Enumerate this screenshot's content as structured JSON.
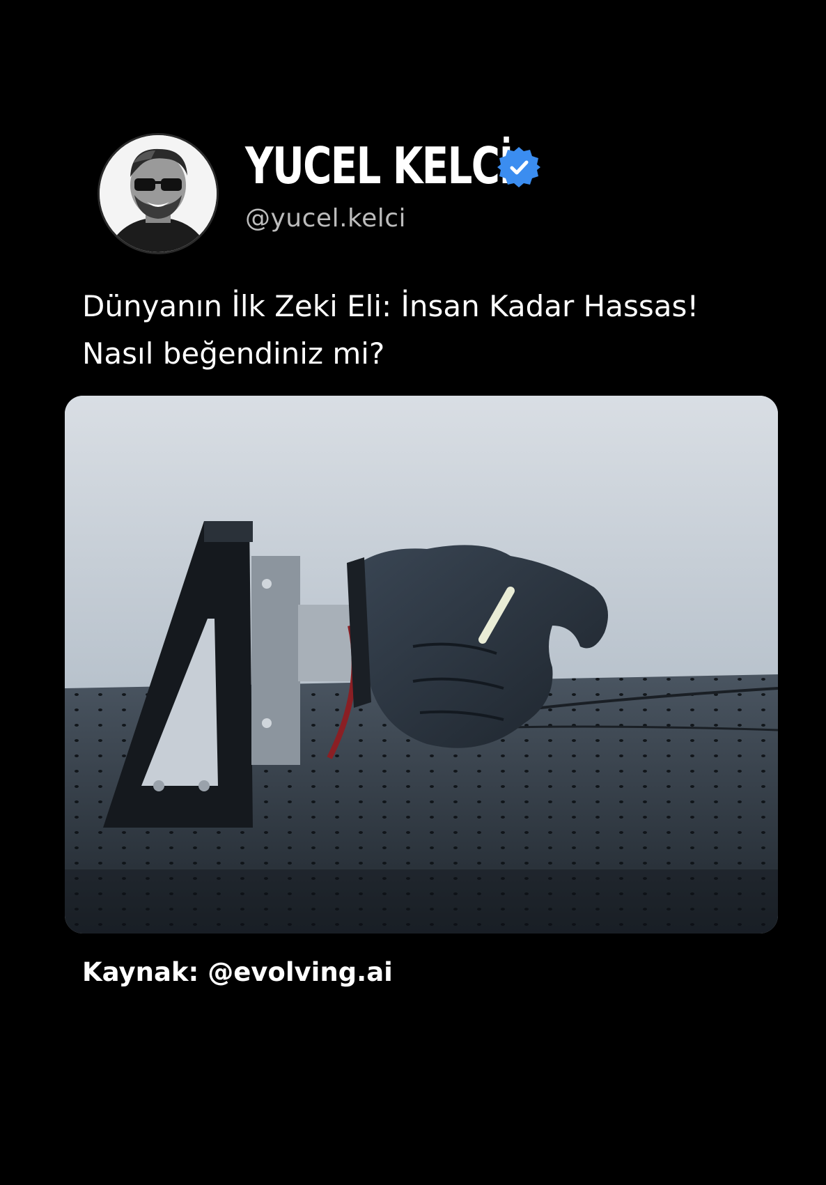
{
  "author": {
    "name": "YUCEL KELCİ",
    "handle": "@yucel.kelci",
    "verified_color": "#3b8df0"
  },
  "caption": {
    "line1": "Dünyanın İlk Zeki Eli: İnsan Kadar Hassas!",
    "line2": "Nasıl beğendiniz mi?"
  },
  "media": {
    "type": "photo",
    "icon": "robotic-hand-photo"
  },
  "source": {
    "text": "Kaynak: @evolving.ai"
  },
  "colors": {
    "background": "#000000",
    "text": "#ffffff",
    "handle": "#bcbcbc",
    "verified": "#3b8df0"
  }
}
